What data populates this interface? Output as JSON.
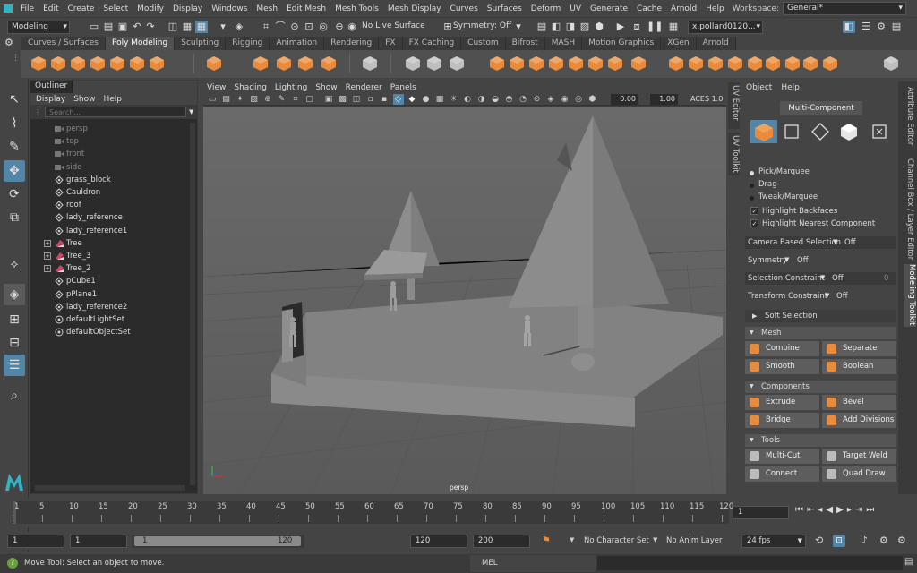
{
  "menubar": {
    "items": [
      "File",
      "Edit",
      "Create",
      "Select",
      "Modify",
      "Display",
      "Windows",
      "Mesh",
      "Edit Mesh",
      "Mesh Tools",
      "Mesh Display",
      "Curves",
      "Surfaces",
      "Deform",
      "UV",
      "Generate",
      "Cache",
      "Arnold",
      "Help"
    ],
    "workspace_label": "Workspace:",
    "workspace_value": "General*"
  },
  "statusline": {
    "menuset": "Modeling",
    "live_surface": "No Live Surface",
    "symmetry": "Symmetry: Off",
    "user": "x.pollard0120..."
  },
  "shelf": {
    "tabs": [
      "Curves / Surfaces",
      "Poly Modeling",
      "Sculpting",
      "Rigging",
      "Animation",
      "Rendering",
      "FX",
      "FX Caching",
      "Custom",
      "Bifrost",
      "MASH",
      "Motion Graphics",
      "XGen",
      "Arnold"
    ],
    "active_tab": "Poly Modeling",
    "accent": "#e98b3a"
  },
  "outliner": {
    "title": "Outliner",
    "menu": [
      "Display",
      "Show",
      "Help"
    ],
    "search_placeholder": "Search...",
    "items": [
      {
        "label": "persp",
        "icon": "camera-icon",
        "dim": true,
        "expand": false
      },
      {
        "label": "top",
        "icon": "camera-icon",
        "dim": true,
        "expand": false
      },
      {
        "label": "front",
        "icon": "camera-icon",
        "dim": true,
        "expand": false
      },
      {
        "label": "side",
        "icon": "camera-icon",
        "dim": true,
        "expand": false
      },
      {
        "label": "grass_block",
        "icon": "transform-icon",
        "dim": false,
        "expand": false
      },
      {
        "label": "Cauldron",
        "icon": "transform-icon",
        "dim": false,
        "expand": false
      },
      {
        "label": "roof",
        "icon": "transform-icon",
        "dim": false,
        "expand": false
      },
      {
        "label": "lady_reference",
        "icon": "transform-icon",
        "dim": false,
        "expand": false
      },
      {
        "label": "lady_reference1",
        "icon": "transform-icon",
        "dim": false,
        "expand": false
      },
      {
        "label": "Tree",
        "icon": "group-icon",
        "dim": false,
        "expand": true
      },
      {
        "label": "Tree_3",
        "icon": "group-icon",
        "dim": false,
        "expand": true
      },
      {
        "label": "Tree_2",
        "icon": "group-icon",
        "dim": false,
        "expand": true
      },
      {
        "label": "pCube1",
        "icon": "transform-icon",
        "dim": false,
        "expand": false
      },
      {
        "label": "pPlane1",
        "icon": "transform-icon",
        "dim": false,
        "expand": false
      },
      {
        "label": "lady_reference2",
        "icon": "transform-icon",
        "dim": false,
        "expand": false
      },
      {
        "label": "defaultLightSet",
        "icon": "set-icon",
        "dim": false,
        "expand": false
      },
      {
        "label": "defaultObjectSet",
        "icon": "set-icon",
        "dim": false,
        "expand": false
      }
    ]
  },
  "viewport": {
    "menu": [
      "View",
      "Shading",
      "Lighting",
      "Show",
      "Renderer",
      "Panels"
    ],
    "field1": "0.00",
    "field2": "1.00",
    "colorspace": "ACES 1.0",
    "camera_label": "persp"
  },
  "side_tabs": {
    "uv_editor": "UV Editor",
    "uv_toolkit": "UV Toolkit",
    "attribute_editor": "Attribute Editor",
    "channel_box": "Channel Box / Layer Editor",
    "modeling_toolkit": "Modeling Toolkit"
  },
  "toolkit": {
    "menu": [
      "Object",
      "Help"
    ],
    "mode_button": "Multi-Component",
    "selection_modes": [
      "Pick/Marquee",
      "Drag",
      "Tweak/Marquee"
    ],
    "checkboxes": [
      "Highlight Backfaces",
      "Highlight Nearest Component"
    ],
    "camera_based": {
      "label": "Camera Based Selection",
      "value": "Off"
    },
    "symmetry": {
      "label": "Symmetry",
      "value": "Off"
    },
    "selection_constraint": {
      "label": "Selection Constraint",
      "value": "Off",
      "num": "0"
    },
    "transform_constraint": {
      "label": "Transform Constraint",
      "value": "Off"
    },
    "soft_selection": "Soft Selection",
    "sections": {
      "mesh": {
        "title": "Mesh",
        "buttons": [
          "Combine",
          "Separate",
          "Smooth",
          "Boolean"
        ]
      },
      "components": {
        "title": "Components",
        "buttons": [
          "Extrude",
          "Bevel",
          "Bridge",
          "Add Divisions"
        ]
      },
      "tools": {
        "title": "Tools",
        "buttons": [
          "Multi-Cut",
          "Target Weld",
          "Connect",
          "Quad Draw"
        ]
      }
    }
  },
  "timeline": {
    "ticks": [
      "1",
      "5",
      "10",
      "15",
      "20",
      "25",
      "30",
      "35",
      "40",
      "45",
      "50",
      "55",
      "60",
      "65",
      "70",
      "75",
      "80",
      "85",
      "90",
      "95",
      "100",
      "105",
      "110",
      "115",
      "120"
    ],
    "current_frame": "1"
  },
  "range": {
    "start": "1",
    "start2": "1",
    "slider_start": "1",
    "slider_end": "120",
    "end": "120",
    "end2": "200",
    "character_set": "No Character Set",
    "anim_layer": "No Anim Layer",
    "fps": "24 fps"
  },
  "helpline": {
    "text": "Move Tool: Select an object to move.",
    "mel": "MEL"
  }
}
